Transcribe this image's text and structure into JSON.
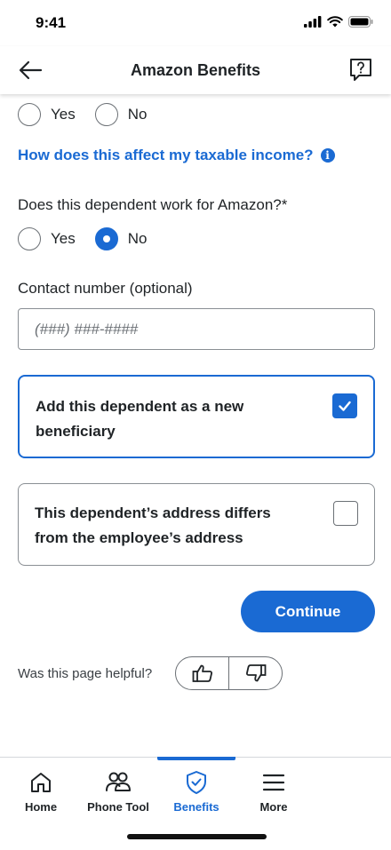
{
  "status": {
    "time": "9:41"
  },
  "header": {
    "title": "Amazon Benefits"
  },
  "radio_group_1": {
    "yes_label": "Yes",
    "no_label": "No"
  },
  "tax_link": {
    "label": "How does this affect my taxable income?"
  },
  "work_question": {
    "label": "Does this dependent work for Amazon?*",
    "yes_label": "Yes",
    "no_label": "No",
    "selected": "No"
  },
  "contact": {
    "label": "Contact number (optional)",
    "placeholder": "(###) ###-####"
  },
  "beneficiary_card": {
    "label": "Add this dependent as a new beneficiary",
    "checked": true
  },
  "address_card": {
    "label": "This dependent’s address differs from the employee’s address",
    "checked": false
  },
  "continue_button": {
    "label": "Continue"
  },
  "feedback": {
    "label": "Was this page helpful?"
  },
  "nav": {
    "items": [
      {
        "label": "Home",
        "icon": "home-icon"
      },
      {
        "label": "Phone Tool",
        "icon": "people-icon"
      },
      {
        "label": "Benefits",
        "icon": "shield-check-icon"
      },
      {
        "label": "More",
        "icon": "menu-icon"
      }
    ],
    "active": "Benefits"
  },
  "colors": {
    "accent": "#1a6ad3",
    "text": "#1f2326",
    "border": "#8a8f94"
  }
}
